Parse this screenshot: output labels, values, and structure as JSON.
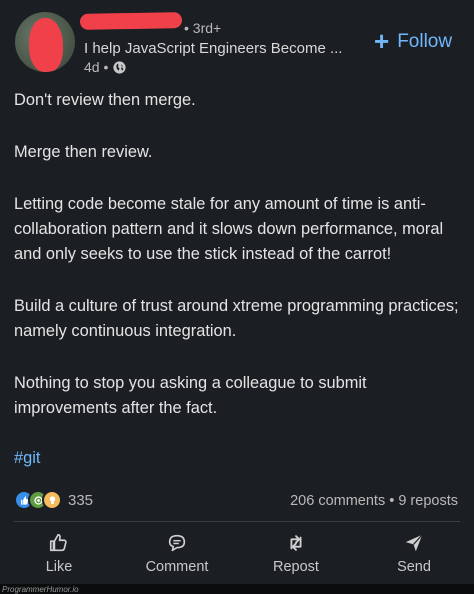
{
  "header": {
    "degree": "• 3rd+",
    "headline": "I help JavaScript Engineers Become ...",
    "time": "4d •",
    "follow_label": "Follow",
    "follow_plus": "+"
  },
  "body": {
    "paragraphs": [
      "Don't review then merge.",
      "Merge then review.",
      "Letting code become stale for any amount of time is anti-collaboration pattern and it slows down performance, moral and only seeks to use the stick instead of the carrot!",
      "Build a culture of trust around xtreme programming practices; namely continuous integration.",
      "Nothing to stop you asking a colleague to submit improvements after the fact."
    ],
    "hashtag": "#git"
  },
  "social": {
    "reaction_count": "335",
    "stats": "206 comments • 9 reposts",
    "reaction_icons": [
      "like-icon",
      "celebrate-icon",
      "insightful-icon"
    ]
  },
  "actions": {
    "like": "Like",
    "comment": "Comment",
    "repost": "Repost",
    "send": "Send"
  },
  "watermark": "ProgrammerHumor.io",
  "colors": {
    "background": "#1b1f23",
    "link": "#71b7fb",
    "redaction": "#f0414b"
  }
}
